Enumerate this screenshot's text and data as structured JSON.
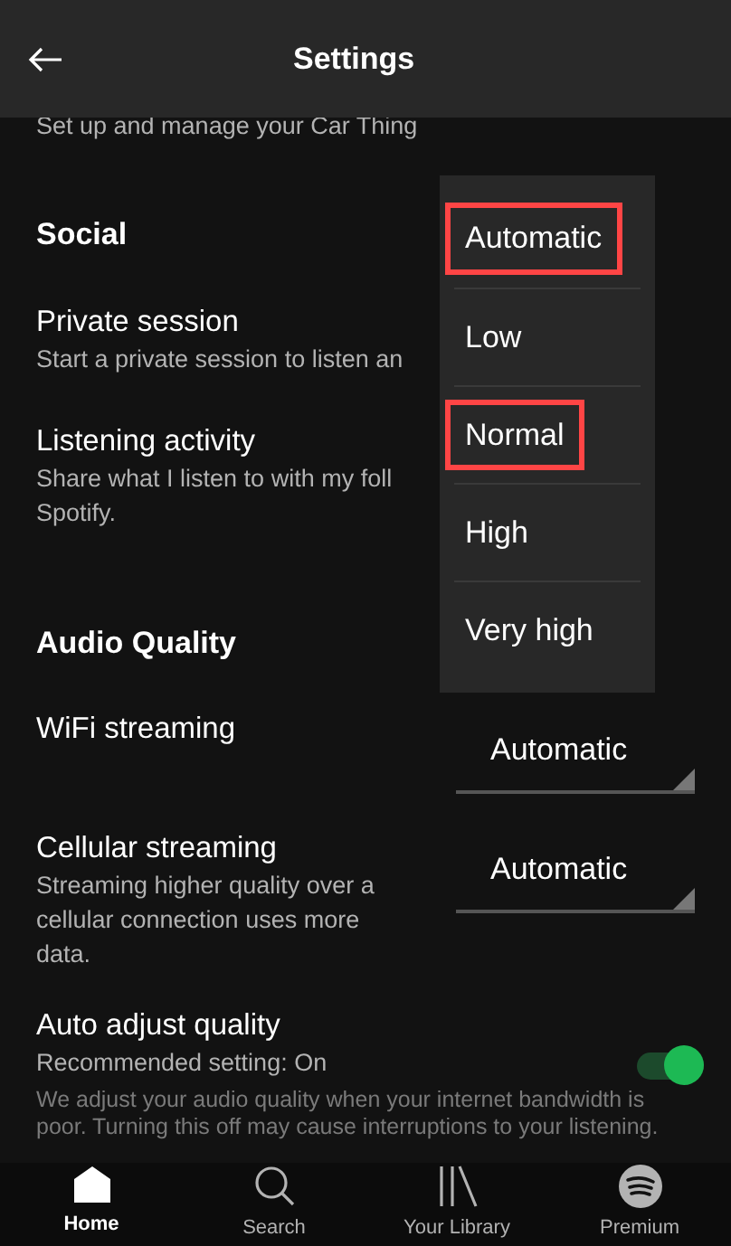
{
  "header": {
    "title": "Settings"
  },
  "items": [
    {
      "kind": "note",
      "text": "Set up and manage your Car Thing"
    },
    {
      "kind": "heading",
      "text": "Social"
    },
    {
      "kind": "setting",
      "title": "Private session",
      "subtitle_lines": [
        "Start a private session to listen an"
      ]
    },
    {
      "kind": "setting",
      "title": "Listening activity",
      "subtitle_lines": [
        "Share what I listen to with my foll",
        "Spotify."
      ]
    },
    {
      "kind": "heading",
      "text": "Audio Quality"
    },
    {
      "kind": "select",
      "title": "WiFi streaming",
      "value": "Automatic"
    },
    {
      "kind": "select",
      "title": "Cellular streaming",
      "subtitle_lines": [
        "Streaming higher quality over a",
        "cellular connection uses more",
        "data."
      ],
      "value": "Automatic"
    },
    {
      "kind": "toggle",
      "title": "Auto adjust quality",
      "subtitle_lines": [
        "Recommended setting: On"
      ],
      "on": true,
      "description": "We adjust your audio quality when your internet bandwidth is poor. Turning this off may cause interruptions to your listening."
    }
  ],
  "dropdown": {
    "options": [
      {
        "label": "Automatic",
        "highlighted": true
      },
      {
        "label": "Low",
        "highlighted": false
      },
      {
        "label": "Normal",
        "highlighted": true
      },
      {
        "label": "High",
        "highlighted": false
      },
      {
        "label": "Very high",
        "highlighted": false
      }
    ]
  },
  "nav": [
    {
      "label": "Home",
      "selected": true
    },
    {
      "label": "Search",
      "selected": false
    },
    {
      "label": "Your Library",
      "selected": false
    },
    {
      "label": "Premium",
      "selected": false
    }
  ]
}
